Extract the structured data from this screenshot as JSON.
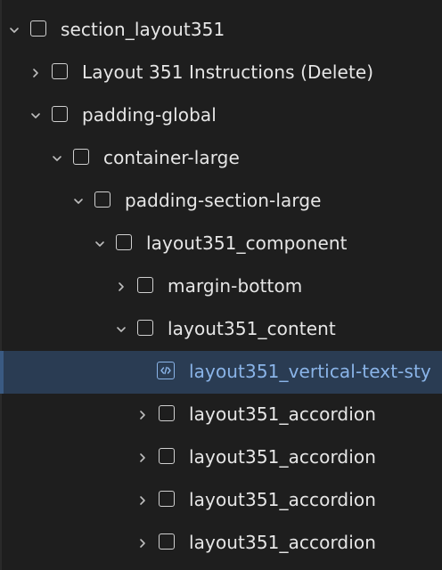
{
  "tree": {
    "items": [
      {
        "label": "section_layout351",
        "expanded": true,
        "icon": "element-box-icon"
      },
      {
        "label": "Layout 351 Instructions (Delete)",
        "expanded": false,
        "icon": "element-box-icon"
      },
      {
        "label": "padding-global",
        "expanded": true,
        "icon": "element-box-icon"
      },
      {
        "label": "container-large",
        "expanded": true,
        "icon": "element-box-icon"
      },
      {
        "label": "padding-section-large",
        "expanded": true,
        "icon": "element-box-icon"
      },
      {
        "label": "layout351_component",
        "expanded": true,
        "icon": "element-box-icon"
      },
      {
        "label": "margin-bottom",
        "expanded": false,
        "icon": "element-box-icon"
      },
      {
        "label": "layout351_content",
        "expanded": true,
        "icon": "element-box-icon"
      },
      {
        "label": "layout351_vertical-text-sty",
        "selected": true,
        "icon": "code-embed-icon"
      },
      {
        "label": "layout351_accordion",
        "expanded": false,
        "icon": "element-box-icon"
      },
      {
        "label": "layout351_accordion",
        "expanded": false,
        "icon": "element-box-icon"
      },
      {
        "label": "layout351_accordion",
        "expanded": false,
        "icon": "element-box-icon"
      },
      {
        "label": "layout351_accordion",
        "expanded": false,
        "icon": "element-box-icon"
      }
    ]
  },
  "colors": {
    "background": "#1e1e1e",
    "selected_row": "#2a3c53",
    "selected_text": "#8ab4e8",
    "text": "#e6e6e6"
  }
}
